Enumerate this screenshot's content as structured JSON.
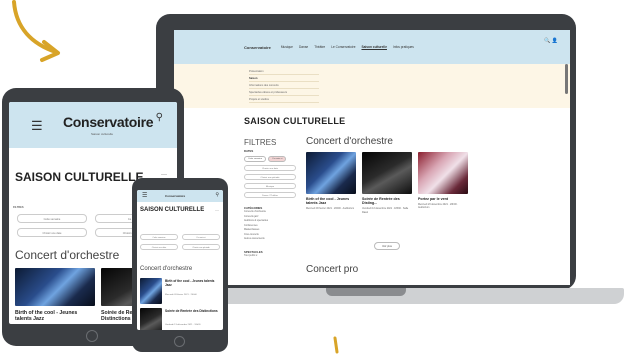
{
  "laptop": {
    "header": {
      "logo": "Conservatoire",
      "nav": [
        "Musique",
        "Danse",
        "Théâtre",
        "Le Conservatoire",
        "Saison culturelle",
        "Infos pratiques"
      ],
      "active_nav": "Saison culturelle",
      "tools": "🔍  👤"
    },
    "dropdown": [
      "Présentation",
      "Saison",
      "Informations des concerts",
      "Spectacles élèves et professeurs",
      "Projets et studios"
    ],
    "page_title": "SAISON CULTURELLE",
    "filters": {
      "title": "FILTRES",
      "dates_label": "DATES",
      "chips": [
        "Cette semaine",
        "Ce mois-ci"
      ],
      "pills": [
        "Choisir une date",
        "Choisir une période",
        "Musique",
        "Danse / Théâtre"
      ],
      "categories_title": "CATÉGORIES",
      "categories": [
        "Concerts d'orchestre",
        "Concerts jazz",
        "Auditions & spectacles",
        "Conférences",
        "Masterclasses",
        "Ciné-concerts",
        "Autres événements"
      ],
      "options_title": "SPECTACLES",
      "options_value": "Tout public  ▾"
    },
    "section": "Concert d'orchestre",
    "cards": [
      {
        "title": "Birth of the cool - Jeunes talents Jazz",
        "meta": "Mercredi 03 février 2021 · 20h00 · Auditorium"
      },
      {
        "title": "Soirée de Rentrée des Disting...",
        "meta": "Vendredi 13 décembre 2021 · 18h30 · Salle Ravel"
      },
      {
        "title": "Portez par le vent",
        "meta": "Mercredi 23 décembre 2021 · 20h00 · Auditorium"
      }
    ],
    "more_button": "Voir plus",
    "section2": "Concert pro"
  },
  "tablet": {
    "logo": "Conservatoire",
    "logo_sub": "Saison culturelle",
    "page_title": "SAISON CULTURELLE",
    "filter_label": "FILTRES",
    "pills": [
      "Cette semaine",
      "Ce mois-ci",
      "Choisir une date",
      "Choisir une période"
    ],
    "section": "Concert d'orchestre",
    "cards": [
      {
        "title": "Birth of the cool - Jeunes talents Jazz"
      },
      {
        "title": "Soirée de Rentrée des Distinctions"
      }
    ]
  },
  "phone": {
    "logo": "Conservatoire",
    "page_title": "SAISON CULTURELLE",
    "pills": [
      "Cette semaine",
      "Ce mois-ci",
      "Choisir une date",
      "Choisir une période"
    ],
    "section": "Concert d'orchestre",
    "rows": [
      {
        "title": "Birth of the cool - Jeunes talents Jazz",
        "meta": "Mercredi 03 février 2021 · 20h00"
      },
      {
        "title": "Soirée de Rentrée des Distinctions",
        "meta": "Vendredi 13 décembre 2021 · 18h30"
      }
    ]
  },
  "colors": {
    "accent_arrow": "#d8a428",
    "device": "#3b3e42",
    "header": "#cde4ef"
  }
}
